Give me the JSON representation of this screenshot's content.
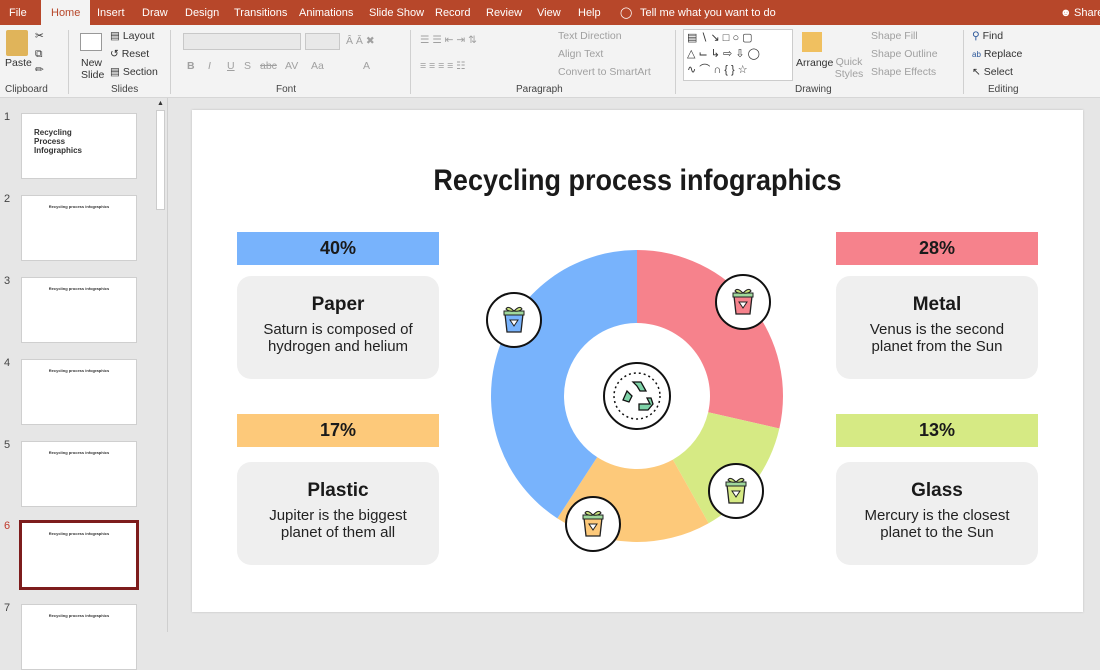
{
  "ribbon_tabs": [
    "File",
    "Home",
    "Insert",
    "Draw",
    "Design",
    "Transitions",
    "Animations",
    "Slide Show",
    "Record",
    "Review",
    "View",
    "Help"
  ],
  "tell_me": "Tell me what you want to do",
  "share": "Share",
  "clipboard": {
    "paste": "Paste",
    "group": "Clipboard"
  },
  "slides_group": {
    "new_slide": "New Slide",
    "layout": "Layout",
    "reset": "Reset",
    "section": "Section",
    "group": "Slides"
  },
  "font_group": {
    "group": "Font",
    "buttons": [
      "B",
      "I",
      "U",
      "S",
      "abc",
      "AV",
      "Aa",
      "A"
    ]
  },
  "paragraph_group": {
    "group": "Paragraph",
    "text_direction": "Text Direction",
    "align_text": "Align Text",
    "convert": "Convert to SmartArt"
  },
  "drawing_group": {
    "group": "Drawing",
    "arrange": "Arrange",
    "quick_styles": "Quick Styles",
    "shape_fill": "Shape Fill",
    "shape_outline": "Shape Outline",
    "shape_effects": "Shape Effects"
  },
  "editing_group": {
    "group": "Editing",
    "find": "Find",
    "replace": "Replace",
    "select": "Select"
  },
  "thumbnails": [
    {
      "num": "1",
      "title": "Recycling Process Infographics"
    },
    {
      "num": "2",
      "title": "Recycling process infographics"
    },
    {
      "num": "3",
      "title": "Recycling process infographics"
    },
    {
      "num": "4",
      "title": "Recycling process infographics"
    },
    {
      "num": "5",
      "title": "Recycling process infographics"
    },
    {
      "num": "6",
      "title": "Recycling process infographics",
      "selected": true
    },
    {
      "num": "7",
      "title": "Recycling process infographics"
    }
  ],
  "slide": {
    "title": "Recycling process infographics",
    "items": [
      {
        "pct": "40%",
        "name": "Paper",
        "desc": "Saturn is composed of hydrogen and helium",
        "color": "#78b3fc"
      },
      {
        "pct": "17%",
        "name": "Plastic",
        "desc": "Jupiter is the biggest planet of them all",
        "color": "#fdc97a"
      },
      {
        "pct": "28%",
        "name": "Metal",
        "desc": "Venus is the second planet from the Sun",
        "color": "#f6828c"
      },
      {
        "pct": "13%",
        "name": "Glass",
        "desc": "Mercury is the closest planet to the Sun",
        "color": "#d6ea84"
      }
    ]
  },
  "chart_data": {
    "type": "pie",
    "donut": true,
    "categories": [
      "Metal",
      "Glass",
      "Plastic",
      "Paper"
    ],
    "values": [
      28,
      13,
      17,
      40
    ],
    "colors": [
      "#f6828c",
      "#d6ea84",
      "#fdc97a",
      "#78b3fc"
    ]
  }
}
